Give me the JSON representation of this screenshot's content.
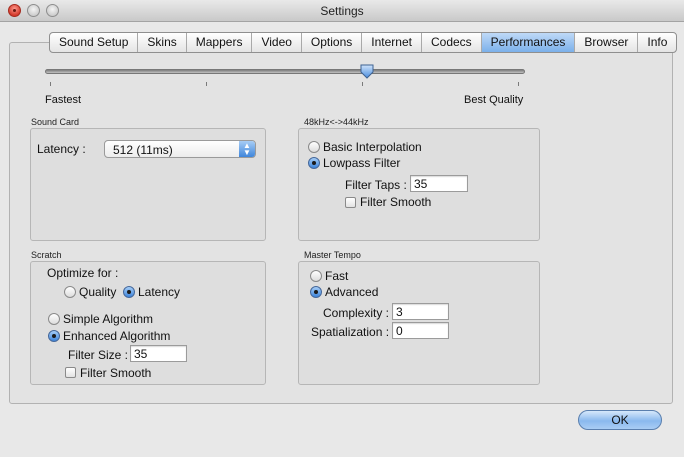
{
  "window": {
    "title": "Settings"
  },
  "tabs": [
    {
      "label": "Sound Setup"
    },
    {
      "label": "Skins"
    },
    {
      "label": "Mappers"
    },
    {
      "label": "Video"
    },
    {
      "label": "Options"
    },
    {
      "label": "Internet"
    },
    {
      "label": "Codecs"
    },
    {
      "label": "Performances",
      "active": true
    },
    {
      "label": "Browser"
    },
    {
      "label": "Info"
    }
  ],
  "quality_slider": {
    "left_label": "Fastest",
    "right_label": "Best Quality",
    "value_fraction": 0.67
  },
  "sound_card": {
    "title": "Sound Card",
    "latency_label": "Latency :",
    "latency_value": "512 (11ms)"
  },
  "resample": {
    "title": "48kHz<->44kHz",
    "basic_label": "Basic Interpolation",
    "lowpass_label": "Lowpass Filter",
    "selected": "lowpass",
    "taps_label": "Filter Taps :",
    "taps_value": "35",
    "smooth_label": "Filter Smooth",
    "smooth_checked": false
  },
  "scratch": {
    "title": "Scratch",
    "optimize_label": "Optimize for :",
    "quality_label": "Quality",
    "latency_label": "Latency",
    "optimize_selected": "latency",
    "simple_label": "Simple Algorithm",
    "enhanced_label": "Enhanced Algorithm",
    "algorithm_selected": "enhanced",
    "size_label": "Filter Size :",
    "size_value": "35",
    "smooth_label": "Filter Smooth",
    "smooth_checked": false
  },
  "master_tempo": {
    "title": "Master Tempo",
    "fast_label": "Fast",
    "advanced_label": "Advanced",
    "selected": "advanced",
    "complexity_label": "Complexity :",
    "complexity_value": "3",
    "spatialization_label": "Spatialization :",
    "spatialization_value": "0"
  },
  "footer": {
    "ok_label": "OK"
  },
  "colors": {
    "accent": "#7bb0ea",
    "close_button": "#d33b2c"
  }
}
